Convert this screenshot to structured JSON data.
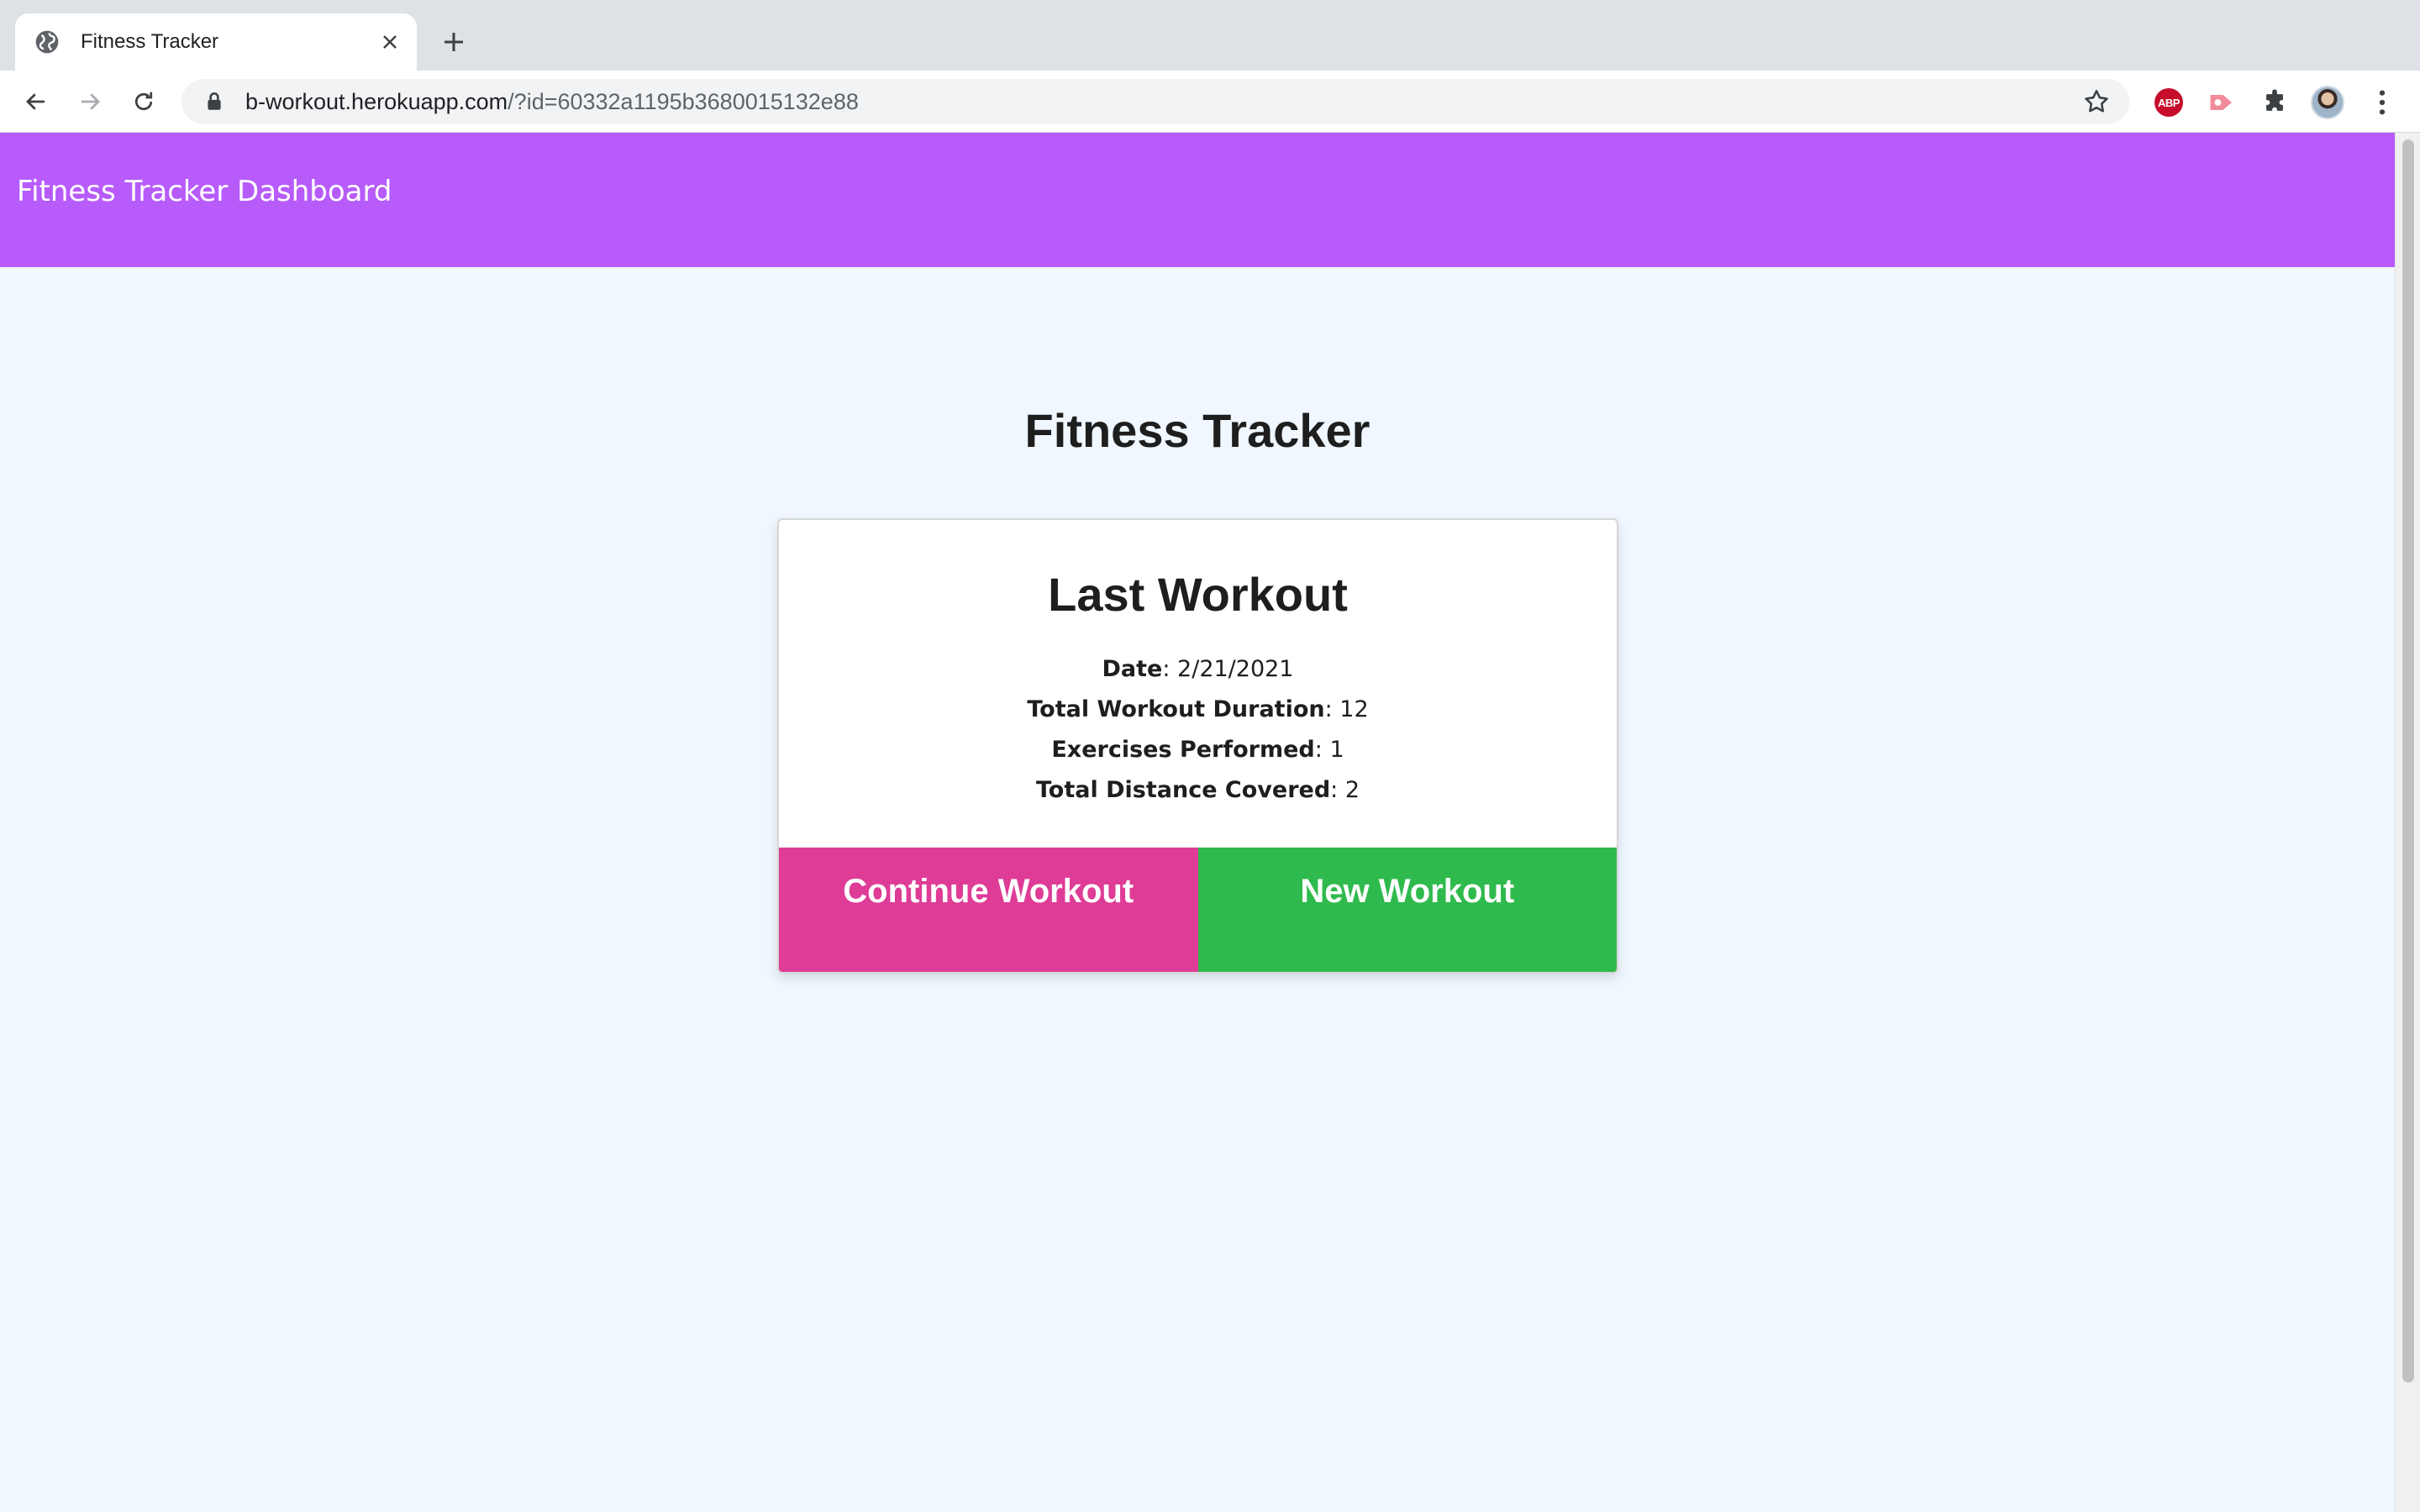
{
  "browser": {
    "tab_title": "Fitness Tracker",
    "url_host": "b-workout.herokuapp.com",
    "url_rest": "/?id=60332a1195b3680015132e88",
    "extension_abp_label": "ABP"
  },
  "nav": {
    "brand": "Fitness Tracker Dashboard"
  },
  "page": {
    "title": "Fitness Tracker"
  },
  "card": {
    "title": "Last Workout",
    "stats": [
      {
        "label": "Date",
        "value": ": 2/21/2021"
      },
      {
        "label": "Total Workout Duration",
        "value": ": 12"
      },
      {
        "label": "Exercises Performed",
        "value": ": 1"
      },
      {
        "label": "Total Distance Covered",
        "value": ": 2"
      }
    ]
  },
  "actions": {
    "continue_label": "Continue Workout",
    "new_label": "New Workout"
  },
  "colors": {
    "navbar": "#b75cfb",
    "page_bg": "#f0f7ff",
    "continue_button": "#de3c97",
    "new_button": "#2fba4d"
  },
  "icons": [
    "globe-icon",
    "close-icon",
    "plus-icon",
    "back-arrow-icon",
    "forward-arrow-icon",
    "reload-icon",
    "lock-icon",
    "star-icon",
    "adblock-icon",
    "cast-icon",
    "puzzle-icon",
    "profile-avatar",
    "kebab-menu-icon"
  ]
}
